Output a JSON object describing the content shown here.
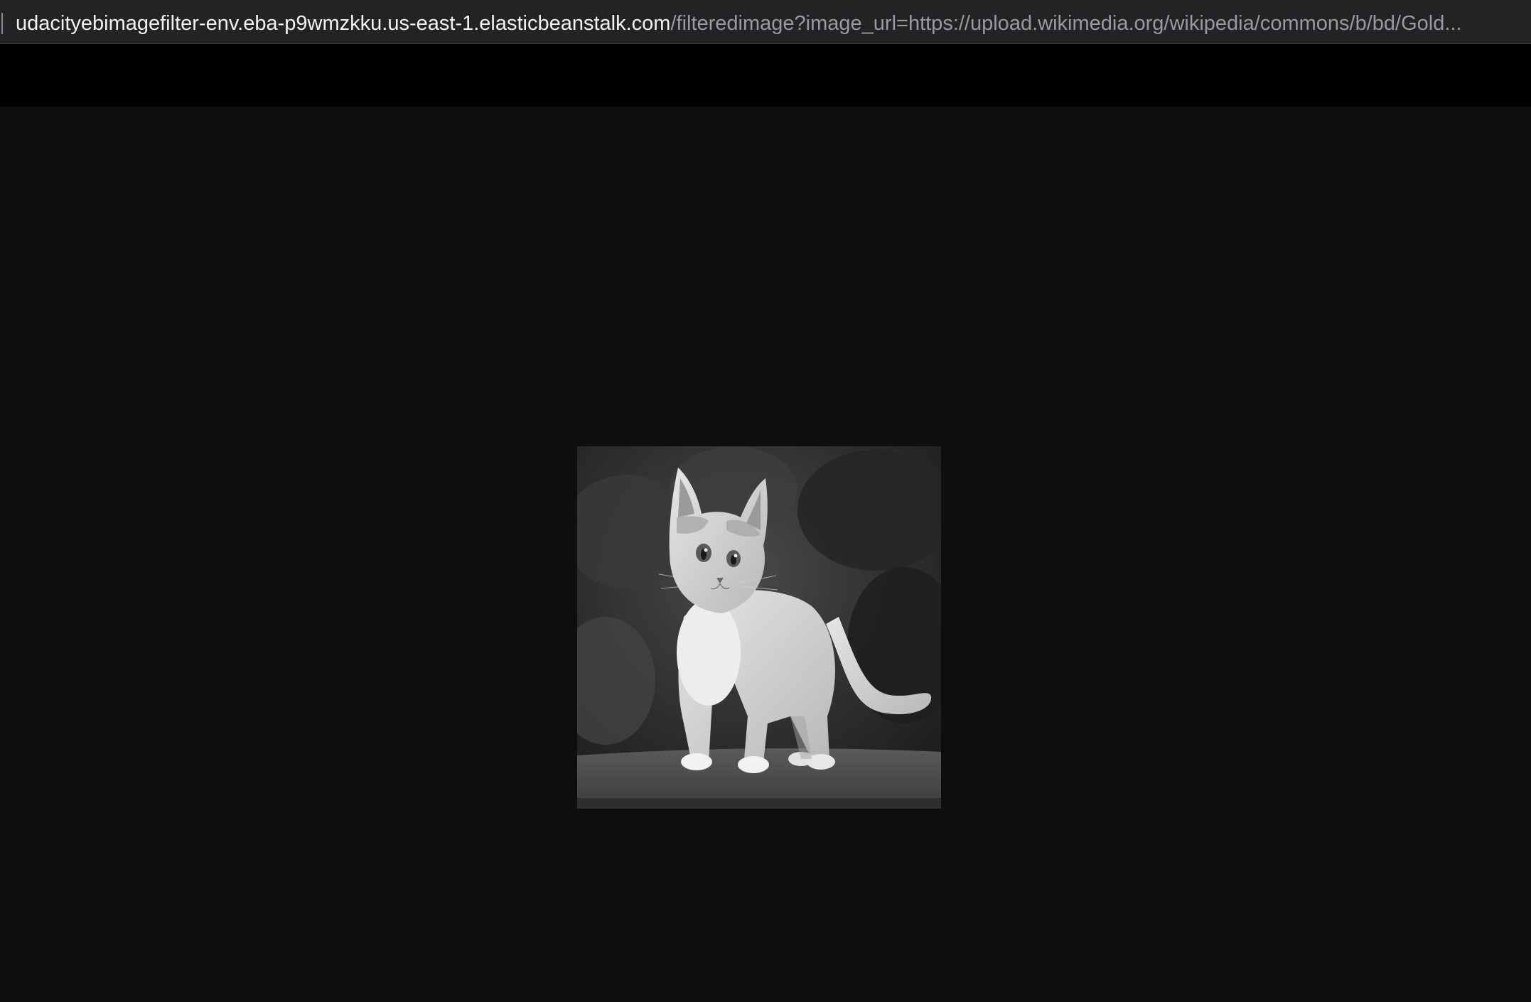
{
  "address_bar": {
    "host": "udacityebimagefilter-env.eba-p9wmzkku.us-east-1.elasticbeanstalk.com",
    "path": "/filteredimage?image_url=https://upload.wikimedia.org/wikipedia/commons/b/bd/Gold..."
  },
  "content": {
    "image_icon": "grayscale-kitten-photo",
    "image_filter": "grayscale"
  }
}
